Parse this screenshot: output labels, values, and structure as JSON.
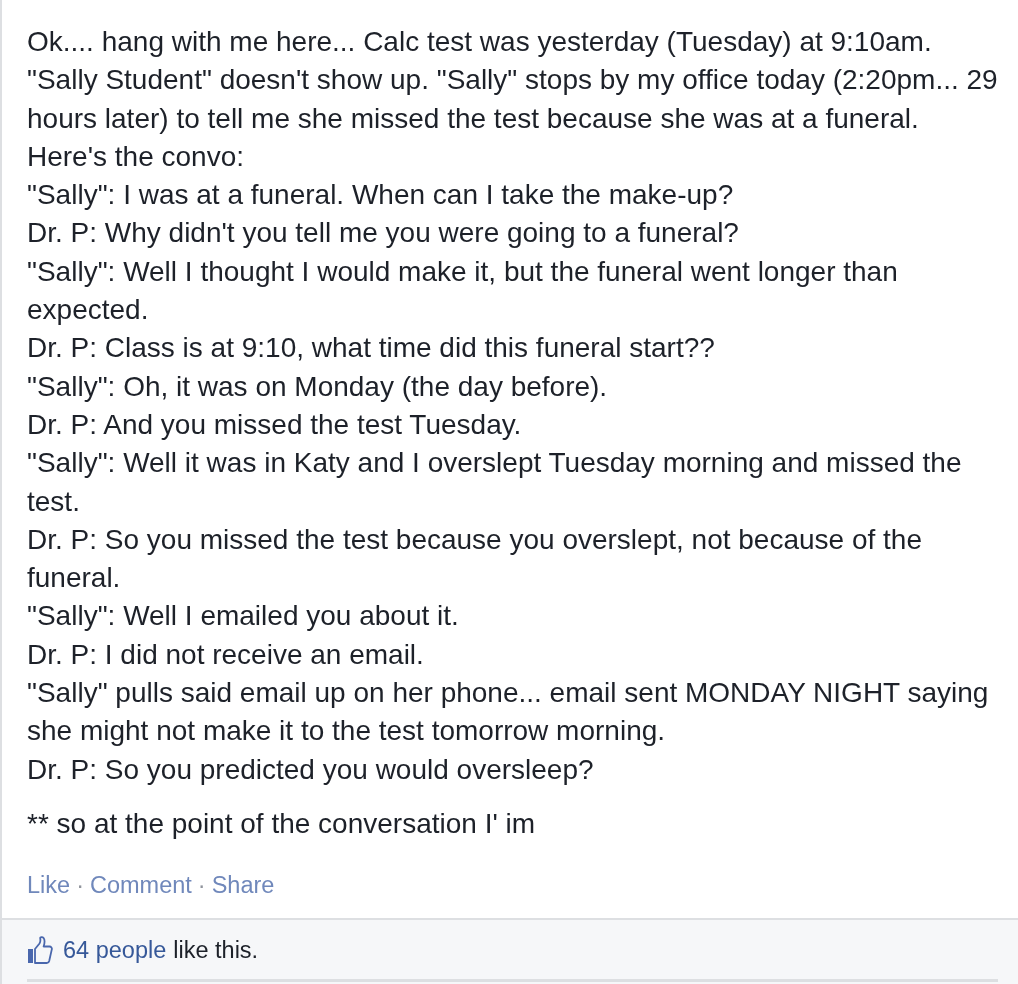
{
  "post": {
    "intro": "Ok.... hang with me here... Calc test was yesterday (Tuesday) at 9:10am. \"Sally Student\" doesn't show up. \"Sally\" stops by my office today (2:20pm... 29 hours later) to tell me she missed the test because she was at a funeral. Here's the convo:",
    "conversation": [
      "\"Sally\": I was at a funeral. When can I take the make-up?",
      "Dr. P: Why didn't you tell me you were going to a funeral?",
      "\"Sally\": Well I thought I would make it, but the funeral went longer than expected.",
      "Dr. P: Class is at 9:10, what time did this funeral start??",
      "\"Sally\": Oh, it was on Monday (the day before).",
      "Dr. P: And you missed the test Tuesday.",
      "\"Sally\": Well it was in Katy and I overslept Tuesday morning and missed the test.",
      "Dr. P: So you missed the test because you overslept, not because of the funeral.",
      "\"Sally\": Well I emailed you about it.",
      "Dr. P: I did not receive an email.",
      "\"Sally\" pulls said email up on her phone... email sent MONDAY NIGHT saying she might not make it to the test tomorrow morning.",
      "Dr. P: So you predicted you would oversleep?"
    ],
    "footnote": "** so at the point of the conversation I' im"
  },
  "actions": {
    "items": [
      "Like",
      "Comment",
      "Share"
    ],
    "separator": "·"
  },
  "likes": {
    "people": "64 people",
    "text": "like this."
  }
}
